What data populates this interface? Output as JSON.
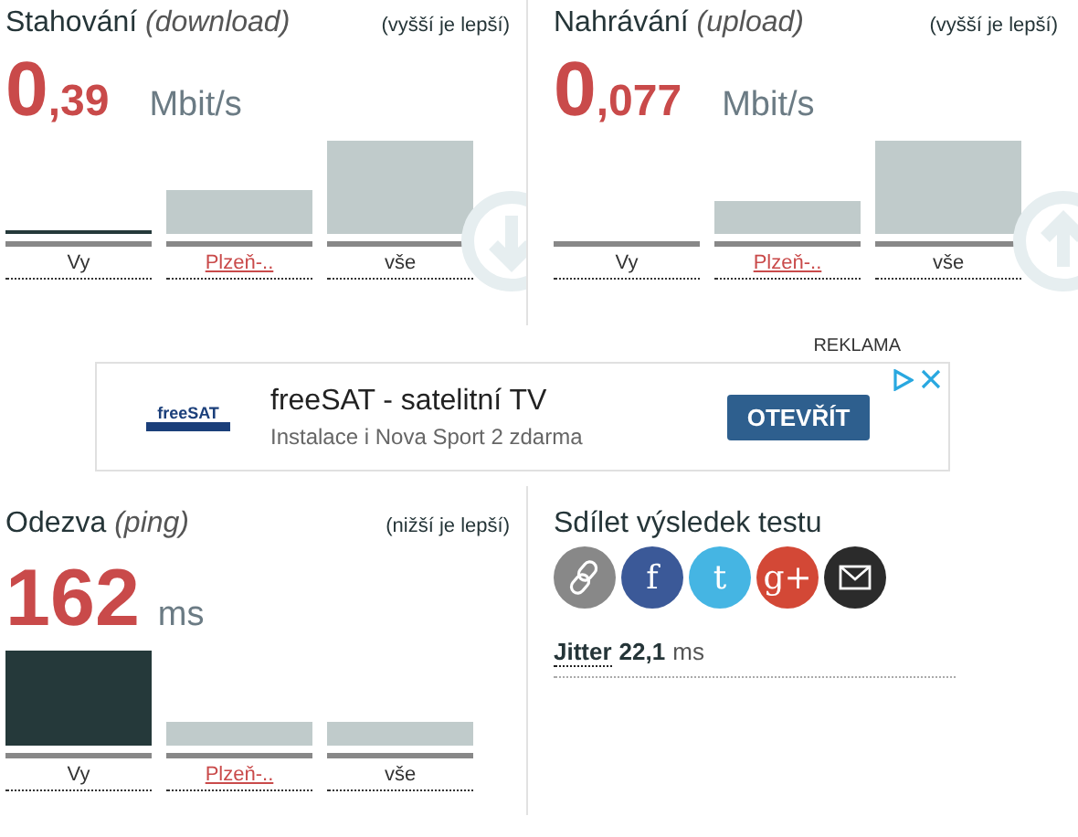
{
  "panels": [
    {
      "kind": "download",
      "title": "Stahování",
      "subtitle": "(download)",
      "note": "(vyšší je lepší)",
      "value_main": "0",
      "value_fraction": ",39",
      "unit": "Mbit/s",
      "bars": [
        {
          "label": "Vy",
          "link": false
        },
        {
          "label": "Plzeň-..",
          "link": true
        },
        {
          "label": "vše",
          "link": false
        }
      ]
    },
    {
      "kind": "upload",
      "title": "Nahrávání",
      "subtitle": "(upload)",
      "note": "(vyšší je lepší)",
      "value_main": "0",
      "value_fraction": ",077",
      "unit": "Mbit/s",
      "bars": [
        {
          "label": "Vy",
          "link": false
        },
        {
          "label": "Plzeň-..",
          "link": true
        },
        {
          "label": "vše",
          "link": false
        }
      ]
    }
  ],
  "ad": {
    "label": "REKLAMA",
    "logo_text": "freeSAT",
    "title": "freeSAT - satelitní TV",
    "text": "Instalace i Nova Sport 2 zdarma",
    "button": "OTEVŘÍT"
  },
  "ping": {
    "title": "Odezva",
    "subtitle": "(ping)",
    "note": "(nižší je lepší)",
    "value_main": "162",
    "unit": "ms",
    "bars": [
      {
        "label": "Vy",
        "link": false
      },
      {
        "label": "Plzeň-..",
        "link": true
      },
      {
        "label": "vše",
        "link": false
      }
    ]
  },
  "share": {
    "title": "Sdílet výsledek testu",
    "buttons": [
      {
        "kind": "link",
        "color": "#888888"
      },
      {
        "kind": "glyph",
        "glyph": "f",
        "color": "#3b5998"
      },
      {
        "kind": "glyph",
        "glyph": "t",
        "color": "#45b5e3"
      },
      {
        "kind": "glyph",
        "glyph": "g+",
        "color": "#d34836"
      },
      {
        "kind": "email",
        "color": "#2b2b2b"
      }
    ]
  },
  "jitter": {
    "label": "Jitter",
    "value": "22,1",
    "unit": "ms"
  }
}
